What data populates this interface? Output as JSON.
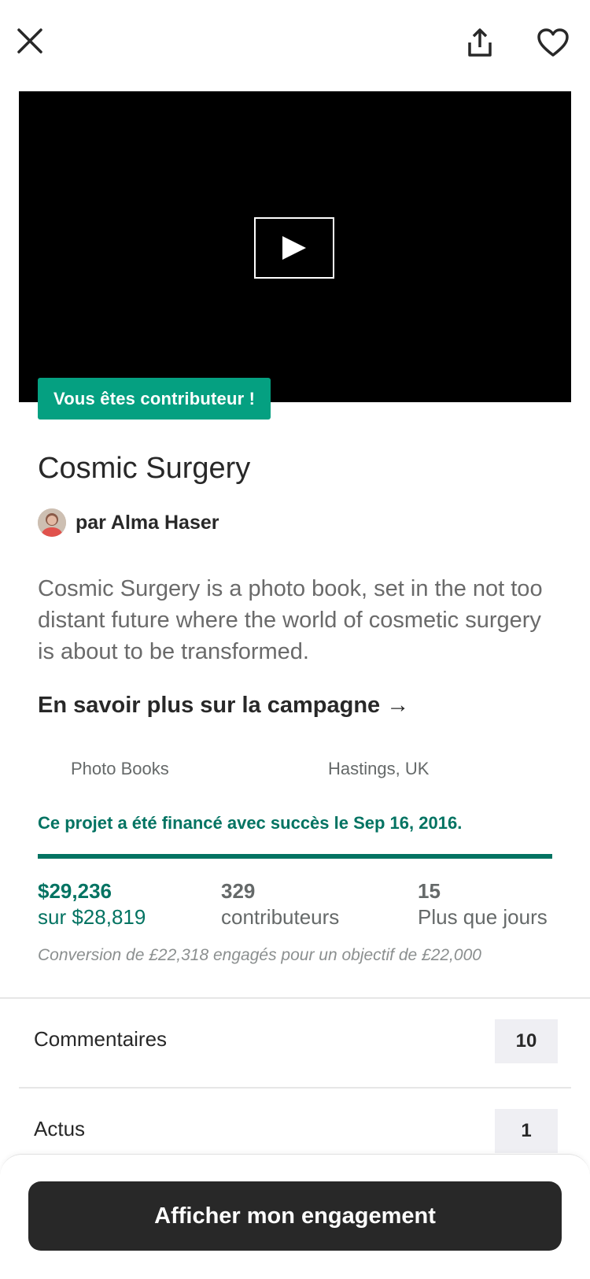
{
  "header": {
    "close_icon": "close-icon",
    "share_icon": "share-icon",
    "favorite_icon": "heart-icon"
  },
  "video": {
    "play_icon": "play-icon"
  },
  "project": {
    "badge": "Vous êtes contributeur !",
    "title": "Cosmic Surgery",
    "creator": "par Alma Haser",
    "description": "Cosmic Surgery is a photo book, set in the not too distant future where the world of cosmetic surgery is about to be transformed.",
    "campaign_link": "En savoir plus sur la campagne →",
    "category": "Photo Books",
    "location": "Hastings, UK"
  },
  "funding": {
    "status": "Ce projet a été financé avec succès le Sep 16, 2016.",
    "progress_percent": 100,
    "pledged": "$29,236",
    "goal": "sur $28,819",
    "backers": "329",
    "backers_label": "contributeurs",
    "days": "15",
    "days_label": "Plus que jours",
    "conversion_note": "Conversion de £22,318 engagés pour un objectif de £22,000",
    "accent_color": "#037362"
  },
  "sections": {
    "comments_label": "Commentaires",
    "comments_count": "10",
    "updates_label": "Actus",
    "updates_count": "1"
  },
  "footer": {
    "cta_label": "Afficher mon engagement"
  }
}
